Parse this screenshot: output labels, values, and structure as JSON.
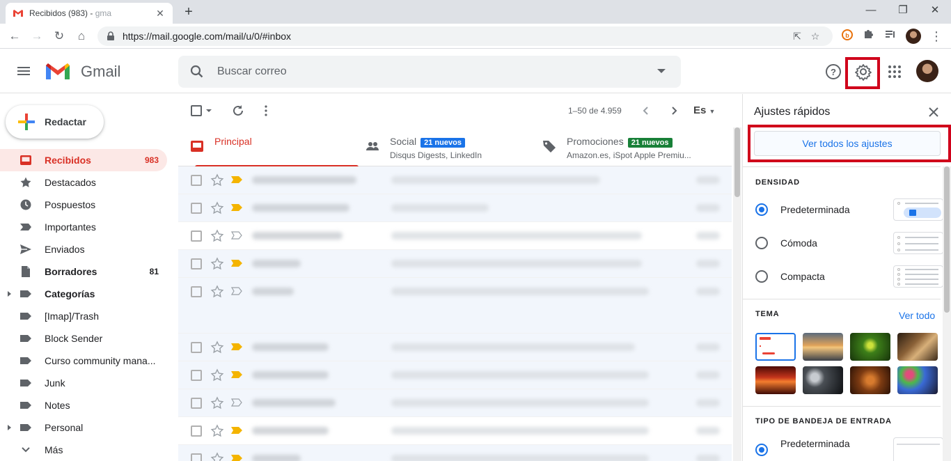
{
  "browser": {
    "tab_title": "Recibidos (983) - ",
    "tab_title_fade": "gma",
    "url": "https://mail.google.com/mail/u/0/#inbox"
  },
  "gmail": {
    "logo_text": "Gmail",
    "search_placeholder": "Buscar correo",
    "compose_label": "Redactar"
  },
  "nav": [
    {
      "label": "Recibidos",
      "count": "983",
      "icon": "inbox-icon",
      "active": true,
      "bold": true
    },
    {
      "label": "Destacados",
      "count": "",
      "icon": "star-icon"
    },
    {
      "label": "Pospuestos",
      "count": "",
      "icon": "clock-icon"
    },
    {
      "label": "Importantes",
      "count": "",
      "icon": "important-icon"
    },
    {
      "label": "Enviados",
      "count": "",
      "icon": "send-icon"
    },
    {
      "label": "Borradores",
      "count": "81",
      "icon": "draft-icon",
      "bold": true
    },
    {
      "label": "Categorías",
      "count": "",
      "icon": "label-icon",
      "bold": true,
      "expand": true
    },
    {
      "label": "[Imap]/Trash",
      "count": "",
      "icon": "label-icon"
    },
    {
      "label": "Block Sender",
      "count": "",
      "icon": "label-icon"
    },
    {
      "label": "Curso community mana...",
      "count": "",
      "icon": "label-icon"
    },
    {
      "label": "Junk",
      "count": "",
      "icon": "label-icon"
    },
    {
      "label": "Notes",
      "count": "",
      "icon": "label-icon"
    },
    {
      "label": "Personal",
      "count": "",
      "icon": "label-icon",
      "expand": true
    },
    {
      "label": "Más",
      "count": "",
      "icon": "chevron-down-icon"
    }
  ],
  "list": {
    "page_info": "1–50 de 4.959",
    "lang": "Es"
  },
  "inbox_tabs": [
    {
      "name": "Principal",
      "sub": "",
      "badge": "",
      "active": true
    },
    {
      "name": "Social",
      "sub": "Disqus Digests, LinkedIn",
      "badge": "21 nuevos",
      "badge_color": "#1a73e8"
    },
    {
      "name": "Promociones",
      "sub": "Amazon.es, iSpot Apple Premiu...",
      "badge": "21 nuevos",
      "badge_color": "#188038"
    }
  ],
  "quick_settings": {
    "title": "Ajustes rápidos",
    "see_all_settings": "Ver todos los ajustes",
    "density_title": "DENSIDAD",
    "density_options": [
      "Predeterminada",
      "Cómoda",
      "Compacta"
    ],
    "density_selected": 0,
    "theme_title": "TEMA",
    "theme_see_all": "Ver todo",
    "inbox_type_title": "TIPO DE BANDEJA DE ENTRADA",
    "inbox_type_default": "Predeterminada"
  },
  "colors": {
    "accent_red": "#d93025",
    "highlight_red": "#d0021b",
    "link_blue": "#1a73e8"
  }
}
